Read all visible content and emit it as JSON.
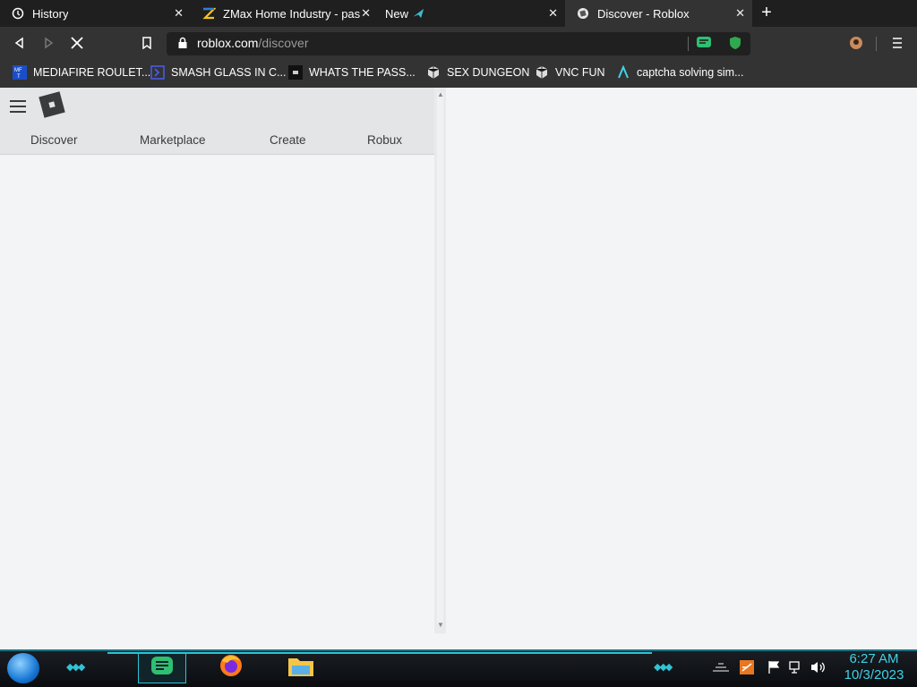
{
  "browser": {
    "tabs": [
      {
        "title": "History",
        "icon": "history-icon",
        "active": false
      },
      {
        "title": "ZMax Home Industry - paspa",
        "icon": "zmax-icon",
        "active": false
      },
      {
        "title": "New",
        "icon": "new-tab-icon",
        "active": false
      },
      {
        "title": "Discover - Roblox",
        "icon": "roblox-favicon-icon",
        "active": true
      }
    ],
    "new_tab_label": "+",
    "close_label": "✕",
    "url_host": "roblox.com",
    "url_path": "/discover"
  },
  "bookmarks": [
    {
      "label": "MEDIAFIRE ROULET...",
      "icon": "mediafire-icon"
    },
    {
      "label": "SMASH GLASS IN C...",
      "icon": "bookmark-chevron-icon"
    },
    {
      "label": "WHATS THE PASS...",
      "icon": "bookmark-square-icon"
    },
    {
      "label": "SEX DUNGEON",
      "icon": "bookmark-cube-icon"
    },
    {
      "label": "VNC FUN",
      "icon": "bookmark-cube-icon"
    },
    {
      "label": "captcha solving sim...",
      "icon": "bookmark-lambda-icon"
    }
  ],
  "roblox": {
    "nav": [
      "Discover",
      "Marketplace",
      "Create",
      "Robux"
    ]
  },
  "taskbar": {
    "time": "6:27 AM",
    "date": "10/3/2023"
  },
  "colors": {
    "accent": "#2ec3d6",
    "header_bg": "#e3e5e7",
    "page_bg": "#f2f4f5"
  }
}
